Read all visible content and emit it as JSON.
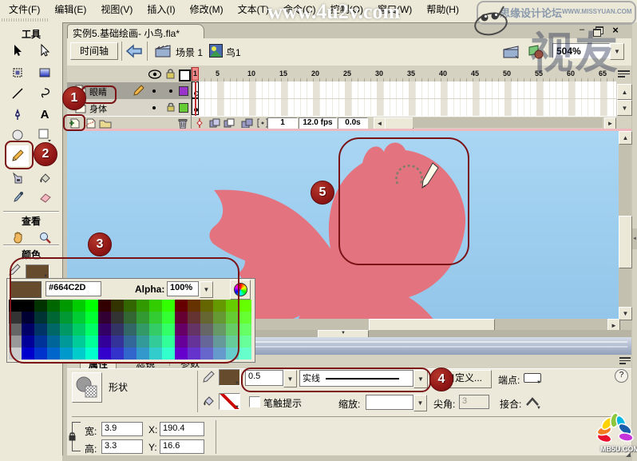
{
  "menu": {
    "items": [
      "文件(F)",
      "编辑(E)",
      "视图(V)",
      "插入(I)",
      "修改(M)",
      "文本(T)",
      "命令(C)",
      "控制(O)",
      "窗口(W)",
      "帮助(H)"
    ]
  },
  "watermarks": {
    "top_text": "www.4u2v.com",
    "forum_name": "思缘设计论坛",
    "forum_url": "WWW.MISSYUAN.COM",
    "stamp_text": "视友",
    "corner_logo_text": "MB5U.COM"
  },
  "document": {
    "tab_title": "实例5.基础绘画- 小鸟.fla*",
    "zoom_value": "504%"
  },
  "edit_bar": {
    "timeline_button": "时间轴",
    "scene_label": "场景 1",
    "symbol_label": "鸟1"
  },
  "timeline": {
    "ruler": [
      "1",
      "5",
      "10",
      "15",
      "20",
      "25",
      "30",
      "35",
      "40",
      "45",
      "50",
      "55",
      "60",
      "65"
    ],
    "layers": [
      {
        "name": "眼睛",
        "selected": true,
        "editing": true,
        "locked": false,
        "outline_color": "#9933CC",
        "keyframe": "hollow"
      },
      {
        "name": "身体",
        "selected": false,
        "editing": false,
        "locked": true,
        "outline_color": "#66CC33",
        "keyframe": "filled"
      }
    ],
    "status": {
      "current_frame": "1",
      "frame_rate": "12.0 fps",
      "elapsed_time": "0.0s"
    }
  },
  "tools": {
    "header": "工具",
    "view_header": "查看",
    "colors_header": "颜色",
    "selected_tool": "pencil",
    "names": [
      "selection",
      "subselection",
      "free-transform",
      "gradient-transform",
      "line",
      "lasso",
      "pen",
      "text",
      "oval",
      "rectangle",
      "pencil",
      "brush",
      "ink-bottle",
      "paint-bucket",
      "eyedropper",
      "eraser",
      "hand",
      "zoom"
    ]
  },
  "color_picker": {
    "current_color": "#664C2D",
    "hex_value": "#664C2D",
    "alpha_label": "Alpha:",
    "alpha_value": "100%",
    "swatch_rows": [
      [
        "#000000",
        "#000000",
        "#003300",
        "#006600",
        "#009900",
        "#00CC00",
        "#00FF00",
        "#330000",
        "#333300",
        "#336600",
        "#339900",
        "#33CC00",
        "#33FF00",
        "#660000",
        "#663300",
        "#666600",
        "#669900",
        "#66CC00",
        "#66FF00"
      ],
      [
        "#333333",
        "#000033",
        "#003333",
        "#006633",
        "#009933",
        "#00CC33",
        "#00FF33",
        "#330033",
        "#333333",
        "#336633",
        "#339933",
        "#33CC33",
        "#33FF33",
        "#660033",
        "#663333",
        "#666633",
        "#669933",
        "#66CC33",
        "#66FF33"
      ],
      [
        "#666666",
        "#000066",
        "#003366",
        "#006666",
        "#009966",
        "#00CC66",
        "#00FF66",
        "#330066",
        "#333366",
        "#336666",
        "#339966",
        "#33CC66",
        "#33FF66",
        "#660066",
        "#663366",
        "#666666",
        "#669966",
        "#66CC66",
        "#66FF66"
      ],
      [
        "#999999",
        "#000099",
        "#003399",
        "#006699",
        "#009999",
        "#00CC99",
        "#00FF99",
        "#330099",
        "#333399",
        "#336699",
        "#339999",
        "#33CC99",
        "#33FF99",
        "#660099",
        "#663399",
        "#666699",
        "#669999",
        "#66CC99",
        "#66FF99"
      ],
      [
        "#CCCCCC",
        "#0000CC",
        "#0033CC",
        "#0066CC",
        "#0099CC",
        "#00CCCC",
        "#00FFCC",
        "#3300CC",
        "#3333CC",
        "#3366CC",
        "#3399CC",
        "#33CCCC",
        "#33FFCC",
        "#6600CC",
        "#6633CC",
        "#6666CC",
        "#6699CC",
        "#66CCCC",
        "#66FFCC"
      ]
    ]
  },
  "properties": {
    "tabs": [
      "属性",
      "滤镜",
      "参数"
    ],
    "active_tab": "属性",
    "shape_label": "形状",
    "stroke_height": "0.5",
    "stroke_style": "实线",
    "custom_button": "自定义...",
    "cap_label": "端点:",
    "stroke_hint_label": "笔触提示",
    "scale_label": "缩放:",
    "scale_value": "",
    "miter_label": "尖角:",
    "miter_value": "3",
    "join_label": "接合:",
    "width_label": "宽:",
    "width_value": "3.9",
    "height_label": "高:",
    "height_value": "3.3",
    "x_label": "X:",
    "x_value": "190.4",
    "y_label": "Y:",
    "y_value": "16.6"
  },
  "annotations": {
    "badges": [
      "1",
      "2",
      "3",
      "4",
      "5"
    ]
  },
  "colors": {
    "sky": "#9CCDEF",
    "sky_top": "#A9D6F3",
    "bird": "#E3747F",
    "annotation_red": "#7A1216",
    "stroke_brown": "#664C2D",
    "layer1_outline": "#9933CC",
    "layer2_outline": "#66CC33"
  }
}
